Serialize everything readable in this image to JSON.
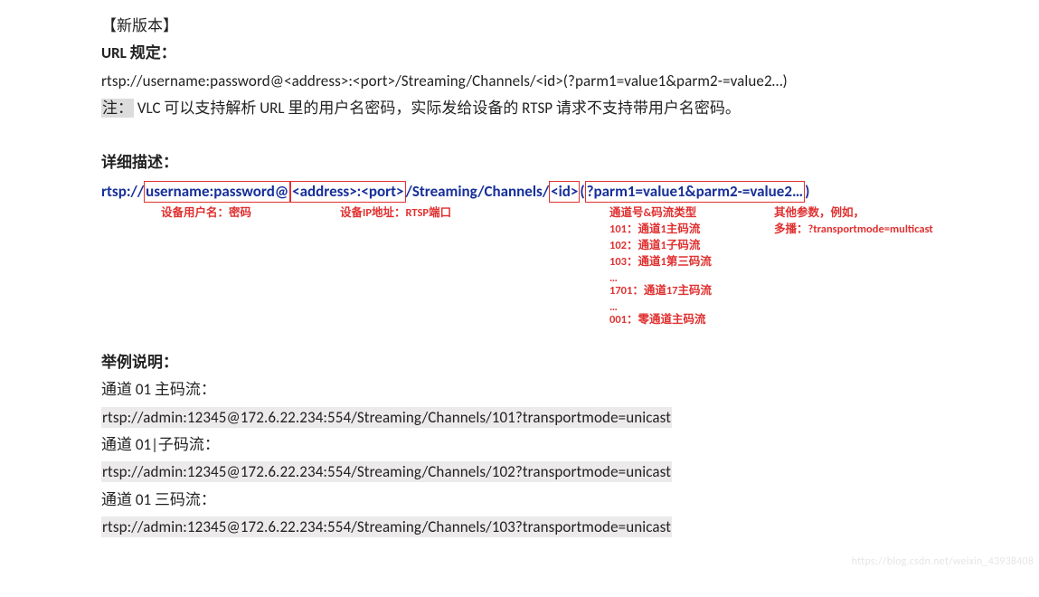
{
  "header_bracket": "【新版本】",
  "url_rule_heading": "URL 规定：",
  "url_rule_line": "rtsp://username:password@<address>:<port>/Streaming/Channels/<id>(?parm1=value1&parm2-=value2…)",
  "note_label": "注：",
  "note_text": "VLC 可以支持解析 URL 里的用户名密码，实际发给设备的 RTSP 请求不支持带用户名密码。",
  "detail_heading": "详细描述：",
  "detail_url": {
    "p1": "rtsp://",
    "b1": "username:password@",
    "b2": "<address>:<port>",
    "p2": "/Streaming/Channels/",
    "b3": "<id>",
    "p3": "(",
    "b4": "?parm1=value1&parm2-=value2…",
    "p4": ")"
  },
  "anno": {
    "a1": "设备用户名：密码",
    "a2": "设备IP地址：RTSP端口",
    "channel_heading": "通道号&码流类型",
    "channel_lines": [
      "101：通道1主码流",
      "102：通道1子码流",
      "103：通道1第三码流",
      "…",
      "1701：通道17主码流",
      "…",
      "001：零通道主码流"
    ],
    "other_heading": "其他参数，例如，",
    "other_line": "多播：?transportmode=multicast"
  },
  "example_heading": "举例说明：",
  "examples": [
    {
      "label": "通道 01 主码流：",
      "url": "rtsp://admin:12345@172.6.22.234:554/Streaming/Channels/101?transportmode=unicast"
    },
    {
      "label": "通道 01|子码流：",
      "url": "rtsp://admin:12345@172.6.22.234:554/Streaming/Channels/102?transportmode=unicast"
    },
    {
      "label": "通道 01 三码流：",
      "url": "rtsp://admin:12345@172.6.22.234:554/Streaming/Channels/103?transportmode=unicast"
    }
  ],
  "watermark": "https://blog.csdn.net/weixin_43938408"
}
